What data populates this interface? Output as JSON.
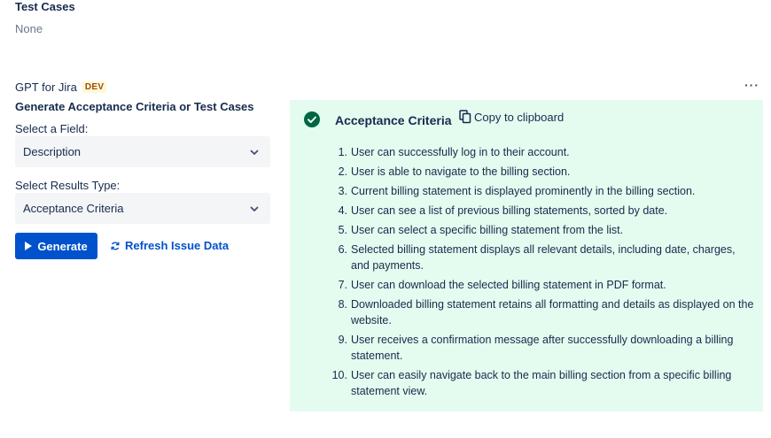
{
  "top_field": {
    "label": "Test Cases",
    "value": "None"
  },
  "app": {
    "title": "GPT for Jira",
    "badge": "DEV",
    "more": "···"
  },
  "form": {
    "section_title": "Generate Acceptance Criteria or Test Cases",
    "field_label": "Select a Field:",
    "field_value": "Description",
    "results_label": "Select Results Type:",
    "results_value": "Acceptance Criteria",
    "generate_label": "Generate",
    "refresh_label": "Refresh Issue Data"
  },
  "result": {
    "title": "Acceptance Criteria",
    "copy_label": "Copy to clipboard",
    "items": [
      "User can successfully log in to their account.",
      "User is able to navigate to the billing section.",
      "Current billing statement is displayed prominently in the billing section.",
      "User can see a list of previous billing statements, sorted by date.",
      "User can select a specific billing statement from the list.",
      "Selected billing statement displays all relevant details, including date, charges, and payments.",
      "User can download the selected billing statement in PDF format.",
      "Downloaded billing statement retains all formatting and details as displayed on the website.",
      "User receives a confirmation message after successfully downloading a billing statement.",
      "User can easily navigate back to the main billing section from a specific billing statement view."
    ]
  },
  "colors": {
    "primary": "#0052cc",
    "success_bg": "#e3fcef",
    "success_icon": "#006644",
    "select_bg": "#f4f5f7"
  },
  "icons": {
    "check": "check-circle-icon",
    "copy": "copy-icon",
    "chevron": "chevron-down-icon",
    "play": "play-icon",
    "refresh": "refresh-icon"
  }
}
